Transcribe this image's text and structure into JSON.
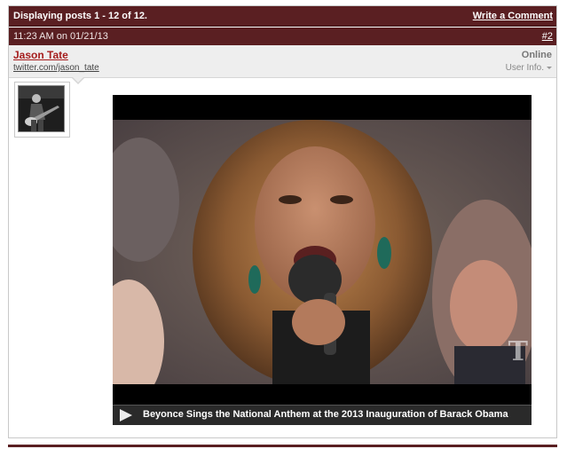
{
  "header": {
    "displaying": "Displaying posts 1 - 12 of 12.",
    "write_comment": "Write a Comment"
  },
  "post": {
    "time_text": "11:23 AM on 01/21/13",
    "post_number": "#2",
    "user": {
      "name": "Jason Tate",
      "twitter": "twitter.com/jason_tate",
      "status": "Online",
      "info_label": "User Info."
    },
    "video": {
      "title": "Beyonce Sings the National Anthem at the 2013 Inauguration of Barack Obama",
      "watermark": "T"
    }
  },
  "colors": {
    "header_bg": "#5a1f22",
    "username": "#a51c1c",
    "userbar_bg": "#eeeeee"
  }
}
